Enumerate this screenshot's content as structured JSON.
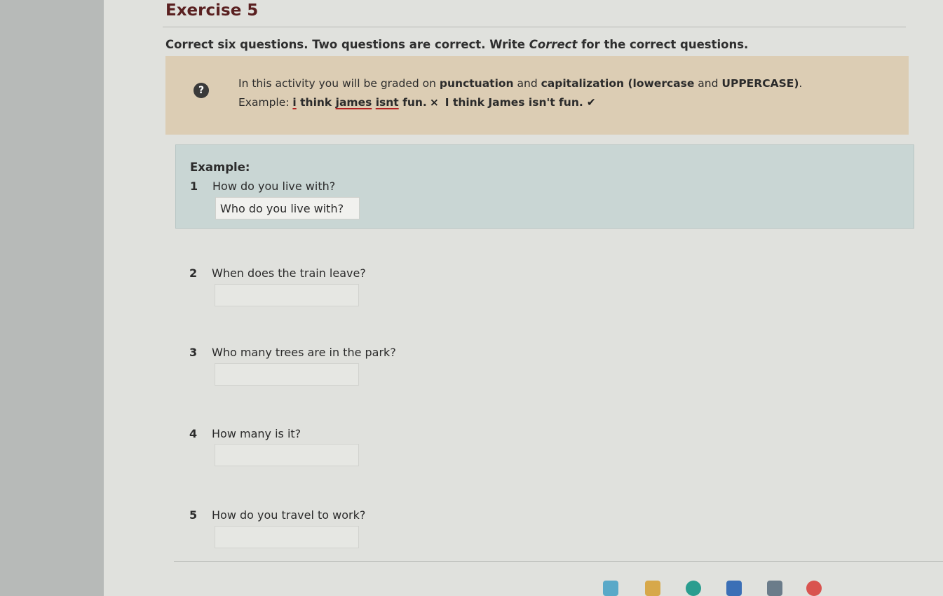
{
  "exercise": {
    "title": "Exercise 5",
    "instruction_pre": "Correct six questions. Two questions are correct. Write ",
    "instruction_em": "Correct",
    "instruction_post": " for the correct questions."
  },
  "notice": {
    "help_icon_glyph": "?",
    "line1_pre": "In this activity you will be graded on ",
    "line1_b1": "punctuation",
    "line1_mid": " and ",
    "line1_b2": "capitalization (lowercase",
    "line1_and": " and ",
    "line1_b3": "UPPERCASE)",
    "line1_end": ".",
    "ex_label": "Example: ",
    "ex_w1": "i",
    "ex_t1": " think ",
    "ex_w2": "james",
    "ex_t2": " ",
    "ex_w3": "isnt",
    "ex_t3": " fun.",
    "cross": "×",
    "ex_correct": "I think James isn't fun.",
    "tick": "✔"
  },
  "example": {
    "label": "Example:",
    "number": "1",
    "question": "How do you live with?",
    "answer": "Who do you live with?"
  },
  "questions": [
    {
      "number": "2",
      "text": "When does the train leave?",
      "answer": ""
    },
    {
      "number": "3",
      "text": "Who many trees are in the park?",
      "answer": ""
    },
    {
      "number": "4",
      "text": "How many is it?",
      "answer": ""
    },
    {
      "number": "5",
      "text": "How do you travel to work?",
      "answer": ""
    }
  ],
  "colors": {
    "title": "#5a2020",
    "notice_bg": "#dccdb4",
    "example_bg": "#c9d6d4",
    "error_underline": "#b22222"
  },
  "taskbar_icons": [
    "chart-icon",
    "folder-icon",
    "edge-icon",
    "store-icon",
    "camera-icon",
    "chrome-icon"
  ]
}
